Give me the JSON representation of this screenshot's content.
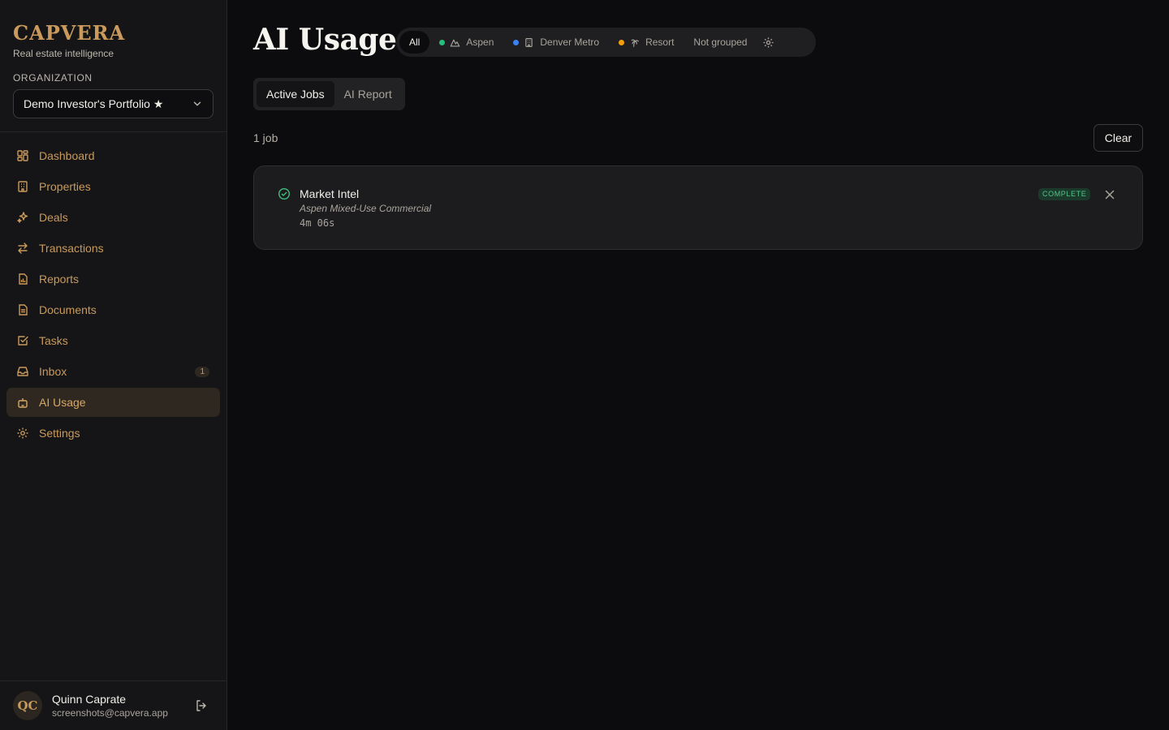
{
  "brand": {
    "name": "CAPVERA",
    "tagline": "Real estate intelligence"
  },
  "organization": {
    "label": "ORGANIZATION",
    "selected": "Demo Investor's Portfolio ★"
  },
  "sidebar": {
    "items": [
      {
        "label": "Dashboard",
        "icon": "dashboard-icon"
      },
      {
        "label": "Properties",
        "icon": "building-icon"
      },
      {
        "label": "Deals",
        "icon": "sparkles-icon"
      },
      {
        "label": "Transactions",
        "icon": "arrows-left-right-icon"
      },
      {
        "label": "Reports",
        "icon": "report-icon"
      },
      {
        "label": "Documents",
        "icon": "document-icon"
      },
      {
        "label": "Tasks",
        "icon": "checkbox-icon"
      },
      {
        "label": "Inbox",
        "icon": "inbox-icon",
        "badge": "1"
      },
      {
        "label": "AI Usage",
        "icon": "robot-icon",
        "active": true
      },
      {
        "label": "Settings",
        "icon": "gear-icon"
      }
    ]
  },
  "user": {
    "initials": "QC",
    "name": "Quinn Caprate",
    "email": "screenshots@capvera.app"
  },
  "page": {
    "title": "AI Usage"
  },
  "filters": {
    "all": "All",
    "aspen": {
      "label": "Aspen",
      "color": "#22c07a"
    },
    "denver": {
      "label": "Denver Metro",
      "color": "#3b82f6"
    },
    "resort": {
      "label": "Resort",
      "color": "#f59e0b"
    },
    "not_grouped": "Not grouped"
  },
  "tabs": {
    "active_jobs": "Active Jobs",
    "ai_report": "AI Report"
  },
  "jobs": {
    "count_label": "1 job",
    "clear_label": "Clear",
    "items": [
      {
        "title": "Market Intel",
        "subtitle": "Aspen Mixed-Use Commercial",
        "duration": "4m 06s",
        "status": "COMPLETE"
      }
    ]
  }
}
